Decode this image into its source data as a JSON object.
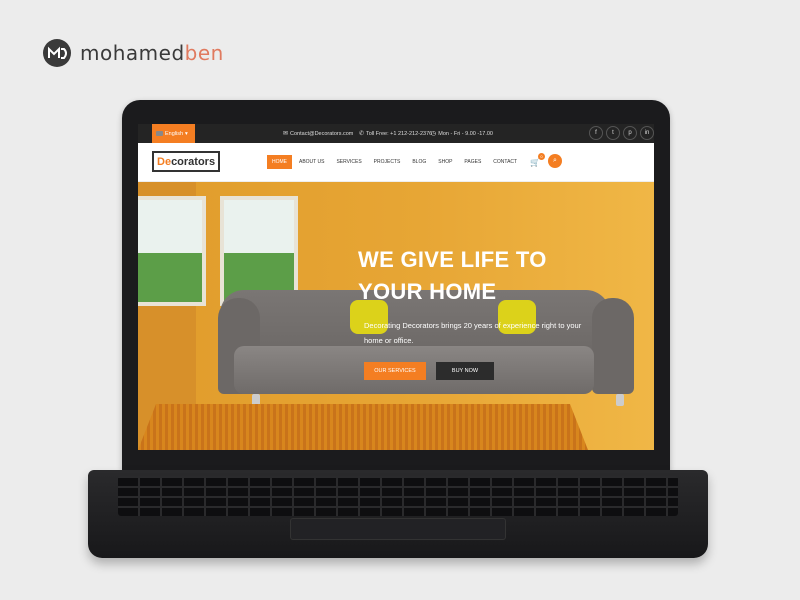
{
  "branding": {
    "name_primary": "mohamed",
    "name_accent": "ben"
  },
  "topbar": {
    "language": "English",
    "email": "Contact@Decorators.com",
    "phone": "Toll Free: +1 212-212-2376",
    "hours": "Mon - Fri - 9.00 -17.00",
    "social": [
      "f",
      "t",
      "p",
      "in"
    ]
  },
  "navbar": {
    "logo_accent": "De",
    "logo_rest": "corators",
    "menu": [
      "HOME",
      "ABOUT US",
      "SERVICES",
      "PROJECTS",
      "BLOG",
      "SHOP",
      "PAGES",
      "CONTACT"
    ],
    "cart_count": "0"
  },
  "hero": {
    "title_line1": "WE GIVE LIFE TO",
    "title_line2": "YOUR HOME",
    "description": "Decorating Decorators brings 20 years of experience right to your home or office.",
    "btn_services": "OUR SERVICES",
    "btn_buy": "BUY NOW"
  },
  "colors": {
    "accent": "#f47e22",
    "dark": "#242424"
  },
  "icons": {
    "email": "envelope-icon",
    "phone": "phone-icon",
    "hours": "clock-icon",
    "cart": "cart-icon",
    "search": "search-icon"
  }
}
